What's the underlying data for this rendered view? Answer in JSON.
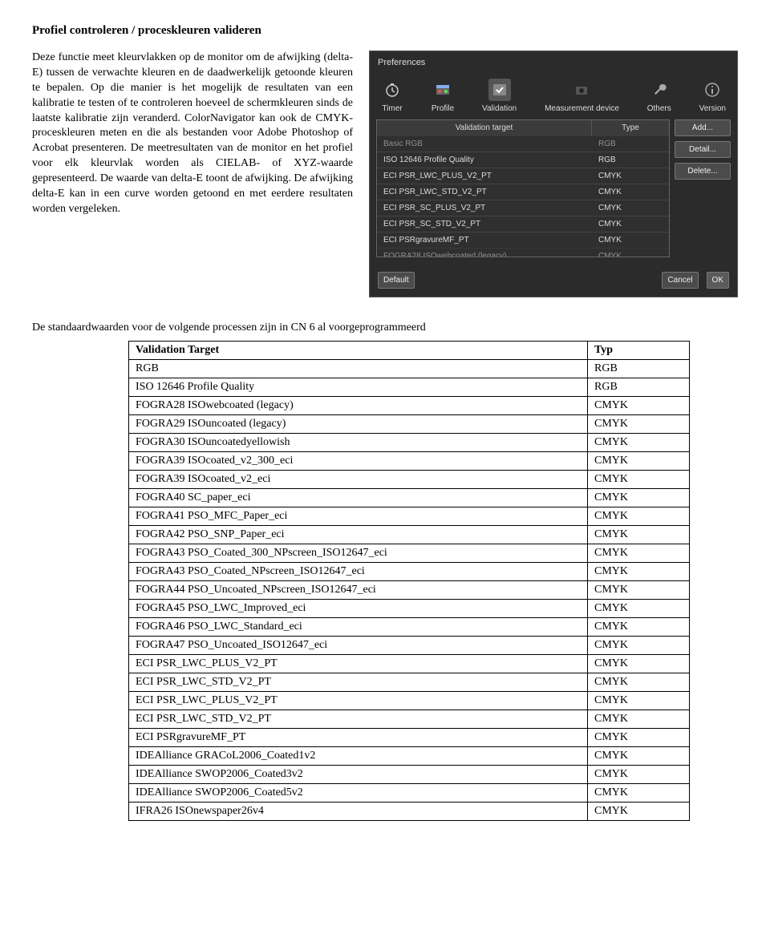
{
  "heading": "Profiel controleren / proceskleuren valideren",
  "para": "Deze functie meet kleurvlakken op de monitor om de afwijking (delta-E) tussen de verwachte kleuren en de daadwerkelijk getoonde kleuren te bepalen. Op die manier is het mogelijk de resultaten van een kalibratie te testen of te controleren hoeveel de schermkleuren sinds de laatste kalibratie zijn veranderd. ColorNavigator kan ook de CMYK-proceskleuren meten en die als bestanden voor Adobe Photoshop of Acrobat presenteren. De meetresultaten van de monitor en het profiel voor elk kleurvlak worden als CIELAB- of XYZ-waarde gepresenteerd. De waarde van delta-E toont de afwijking. De afwijking delta-E kan in een curve worden getoond en met eerdere resultaten worden vergeleken.",
  "prefs": {
    "title": "Preferences",
    "tabs": {
      "timer": "Timer",
      "profile": "Profile",
      "validation": "Validation",
      "measure": "Measurement device",
      "others": "Others",
      "version": "Version"
    },
    "col_target": "Validation target",
    "col_type": "Type",
    "rows": [
      {
        "name": "Basic RGB",
        "type": "RGB",
        "muted": true
      },
      {
        "name": "ISO 12646 Profile Quality",
        "type": "RGB"
      },
      {
        "name": "ECI PSR_LWC_PLUS_V2_PT",
        "type": "CMYK"
      },
      {
        "name": "ECI PSR_LWC_STD_V2_PT",
        "type": "CMYK"
      },
      {
        "name": "ECI PSR_SC_PLUS_V2_PT",
        "type": "CMYK"
      },
      {
        "name": "ECI PSR_SC_STD_V2_PT",
        "type": "CMYK"
      },
      {
        "name": "ECI PSRgravureMF_PT",
        "type": "CMYK"
      },
      {
        "name": "FOGRA28 ISOwebcoated (legacy)",
        "type": "CMYK",
        "muted": true
      }
    ],
    "btn_add": "Add...",
    "btn_detail": "Detail...",
    "btn_delete": "Delete...",
    "btn_default": "Default",
    "btn_cancel": "Cancel",
    "btn_ok": "OK"
  },
  "subhead": "De standaardwaarden voor de volgende processen zijn in CN 6 al voorgeprogrammeerd",
  "table_header": {
    "target": "Validation Target",
    "typ": "Typ"
  },
  "table_rows": [
    {
      "t": "RGB",
      "y": "RGB"
    },
    {
      "t": "ISO 12646 Profile Quality",
      "y": "RGB"
    },
    {
      "t": "FOGRA28 ISOwebcoated (legacy)",
      "y": "CMYK"
    },
    {
      "t": "FOGRA29 ISOuncoated (legacy)",
      "y": "CMYK"
    },
    {
      "t": "FOGRA30 ISOuncoatedyellowish",
      "y": "CMYK"
    },
    {
      "t": "FOGRA39 ISOcoated_v2_300_eci",
      "y": "CMYK"
    },
    {
      "t": "FOGRA39 ISOcoated_v2_eci",
      "y": "CMYK"
    },
    {
      "t": "FOGRA40 SC_paper_eci",
      "y": "CMYK"
    },
    {
      "t": "FOGRA41 PSO_MFC_Paper_eci",
      "y": "CMYK"
    },
    {
      "t": "FOGRA42 PSO_SNP_Paper_eci",
      "y": "CMYK"
    },
    {
      "t": "FOGRA43 PSO_Coated_300_NPscreen_ISO12647_eci",
      "y": "CMYK"
    },
    {
      "t": "FOGRA43 PSO_Coated_NPscreen_ISO12647_eci",
      "y": "CMYK"
    },
    {
      "t": "FOGRA44 PSO_Uncoated_NPscreen_ISO12647_eci",
      "y": "CMYK"
    },
    {
      "t": "FOGRA45 PSO_LWC_Improved_eci",
      "y": "CMYK"
    },
    {
      "t": "FOGRA46 PSO_LWC_Standard_eci",
      "y": "CMYK"
    },
    {
      "t": "FOGRA47 PSO_Uncoated_ISO12647_eci",
      "y": "CMYK"
    },
    {
      "t": "ECI PSR_LWC_PLUS_V2_PT",
      "y": "CMYK"
    },
    {
      "t": "ECI PSR_LWC_STD_V2_PT",
      "y": "CMYK"
    },
    {
      "t": "ECI PSR_LWC_PLUS_V2_PT",
      "y": "CMYK"
    },
    {
      "t": "ECI PSR_LWC_STD_V2_PT",
      "y": "CMYK"
    },
    {
      "t": "ECI PSRgravureMF_PT",
      "y": "CMYK"
    },
    {
      "t": "IDEAlliance GRACoL2006_Coated1v2",
      "y": "CMYK"
    },
    {
      "t": "IDEAlliance SWOP2006_Coated3v2",
      "y": "CMYK"
    },
    {
      "t": "IDEAlliance SWOP2006_Coated5v2",
      "y": "CMYK"
    },
    {
      "t": "IFRA26 ISOnewspaper26v4",
      "y": "CMYK"
    }
  ]
}
